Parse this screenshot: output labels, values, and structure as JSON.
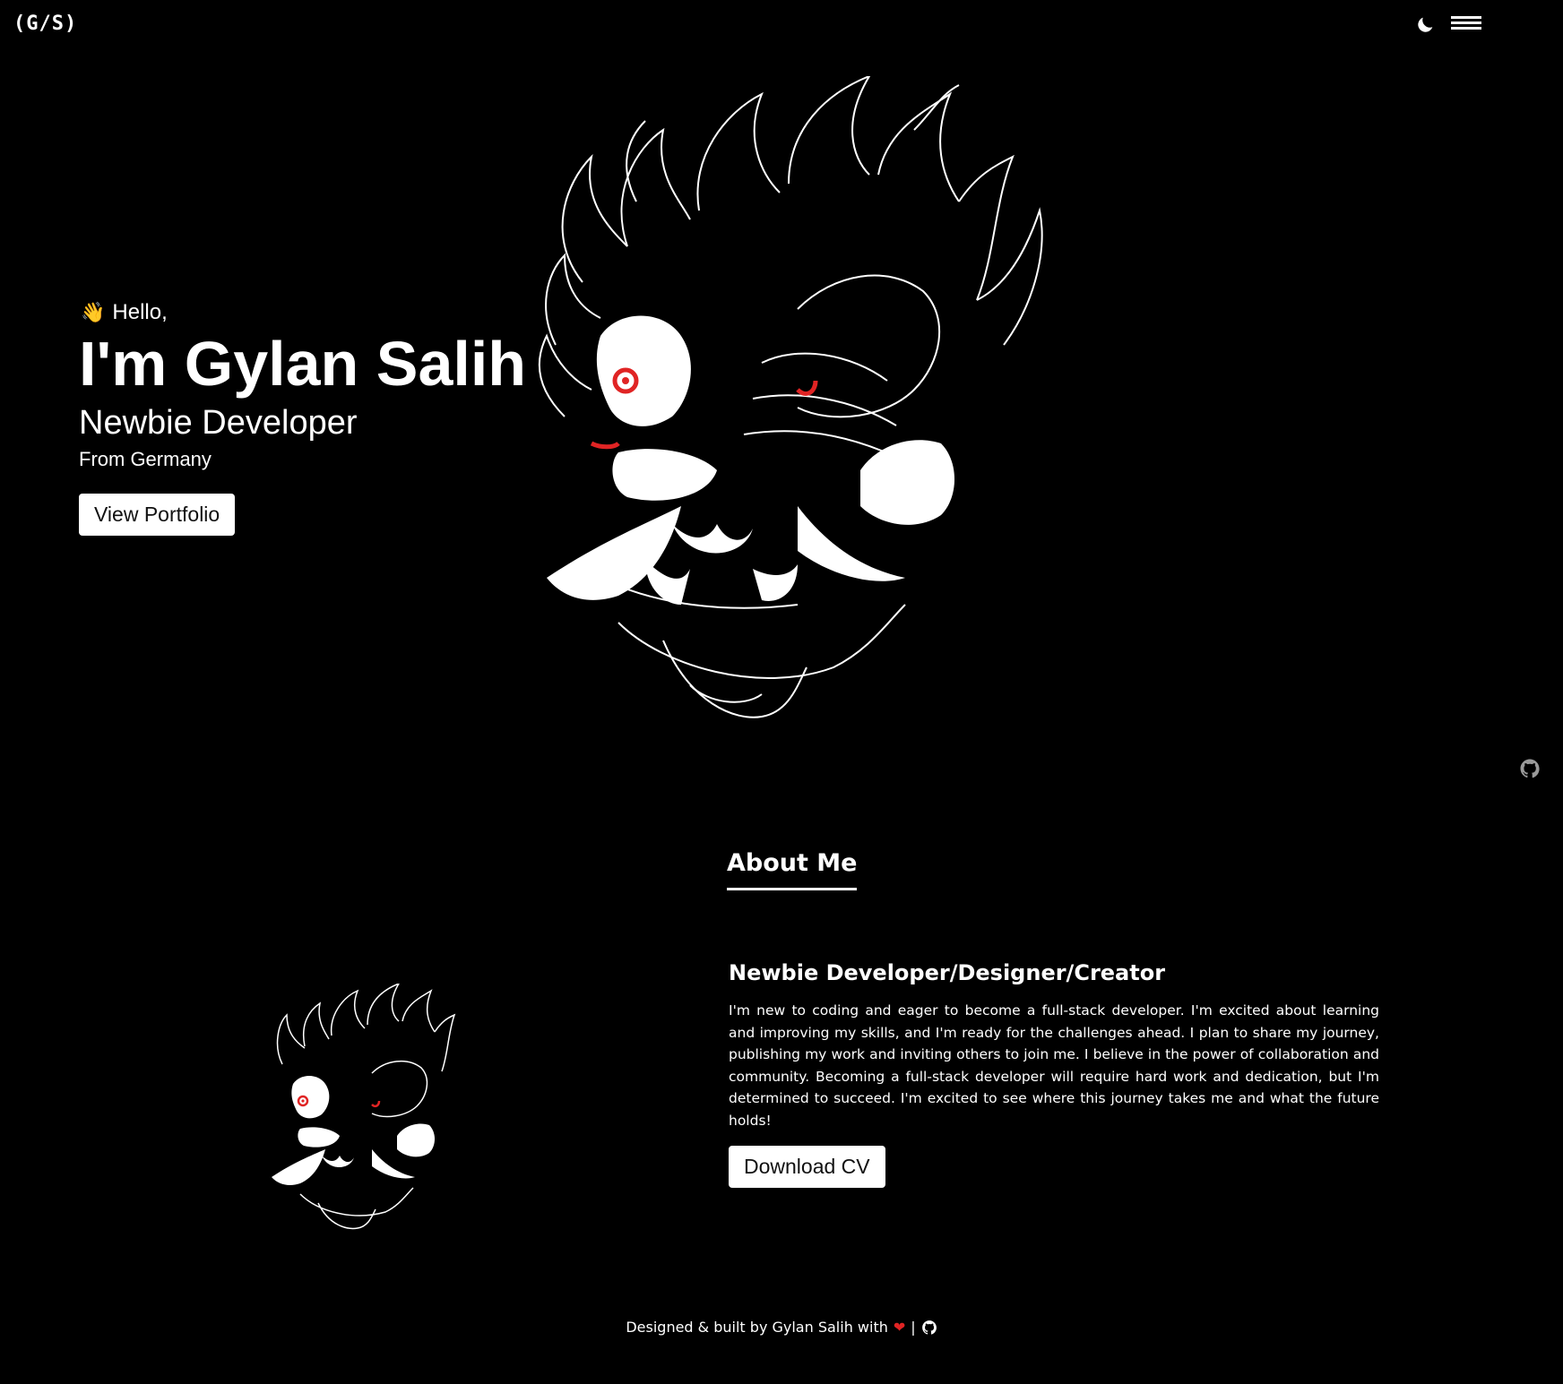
{
  "header": {
    "logo": "(G/S)",
    "theme_icon": "moon-icon",
    "menu_icon": "hamburger-menu-icon"
  },
  "hero": {
    "wave_icon": "👋",
    "greeting": "Hello,",
    "name": "I'm Gylan Salih",
    "role": "Newbie Developer",
    "origin": "From Germany",
    "cta_label": "View Portfolio",
    "image_icon": "samurai-mask-illustration"
  },
  "side": {
    "github_icon": "github-icon"
  },
  "about": {
    "heading": "About Me",
    "subtitle": "Newbie Developer/Designer/Creator",
    "body": "I'm new to coding and eager to become a full-stack developer. I'm excited about learning and improving my skills, and I'm ready for the challenges ahead. I plan to share my journey, publishing my work and inviting others to join me. I believe in the power of collaboration and community. Becoming a full-stack developer will require hard work and dedication, but I'm determined to succeed. I'm excited to see where this journey takes me and what the future holds!",
    "cta_label": "Download CV"
  },
  "footer": {
    "text": "Designed & built by Gylan Salih with",
    "heart": "❤",
    "separator": "|"
  },
  "colors": {
    "background": "#000000",
    "foreground": "#ffffff",
    "accent": "#e02424"
  }
}
